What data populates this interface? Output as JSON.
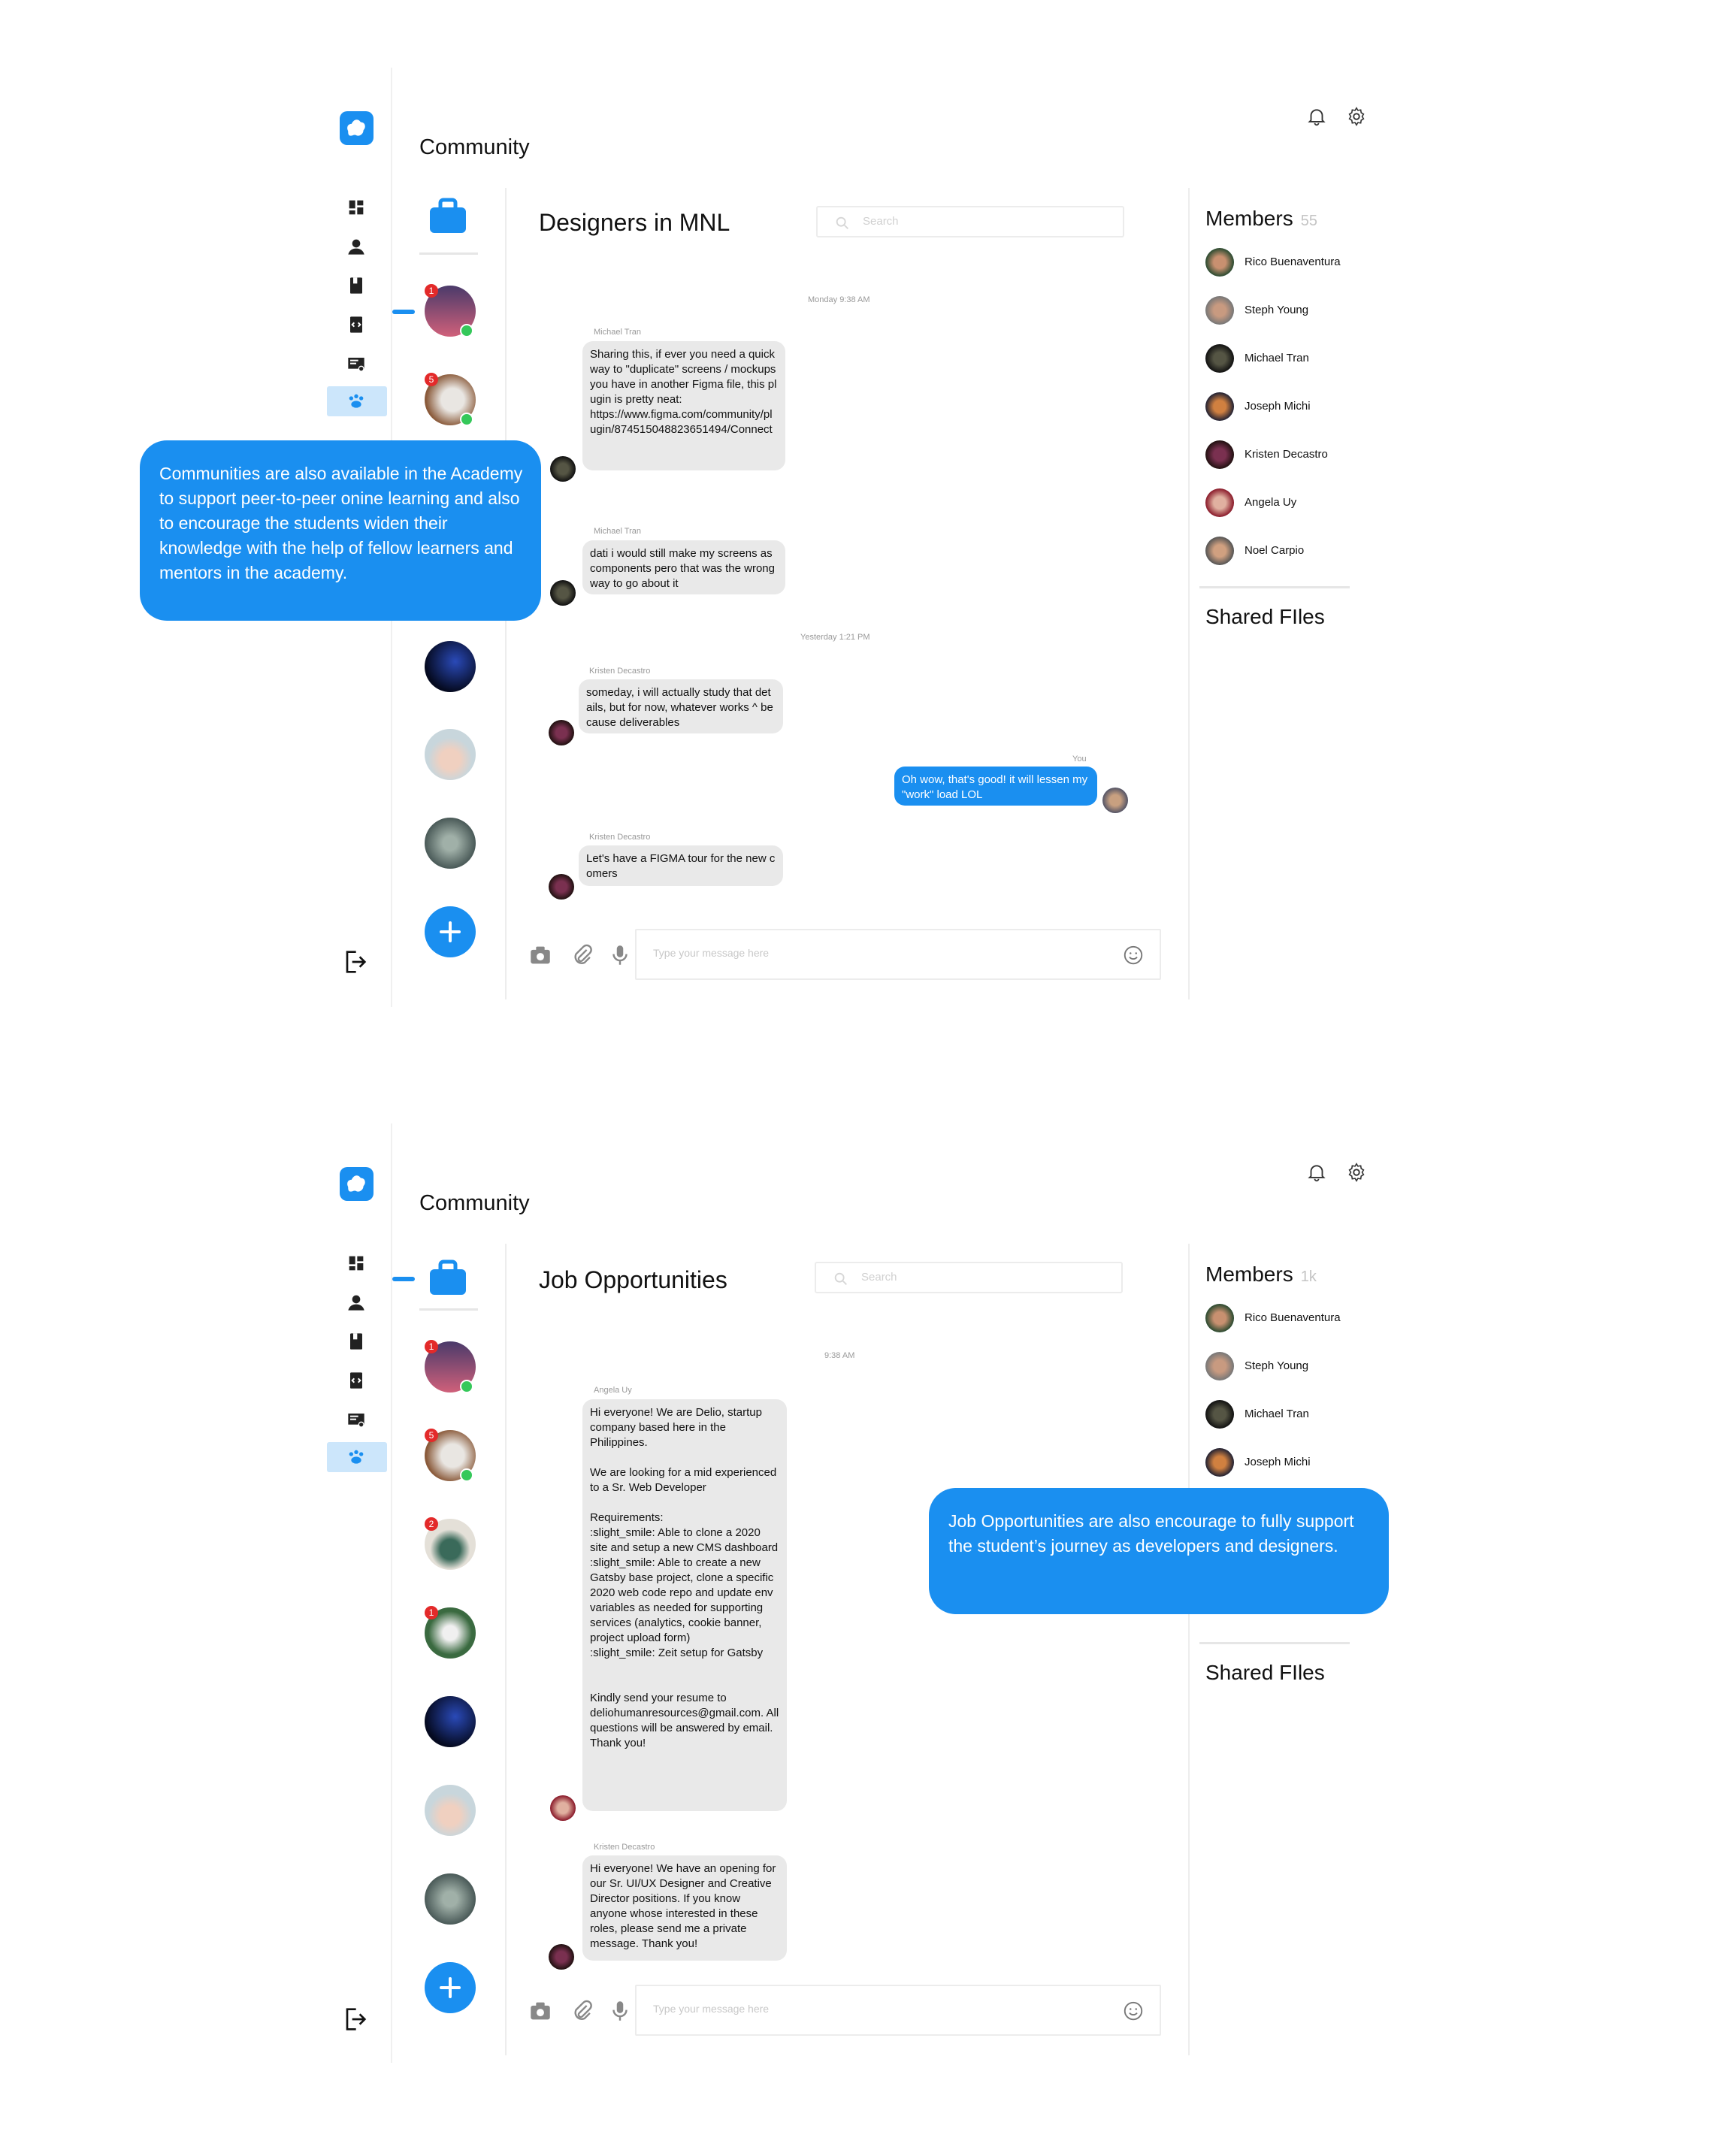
{
  "colors": {
    "accent": "#1a8ff0",
    "badge": "#e32a2a",
    "online": "#35c85a",
    "bubble": "#e9e9e9"
  },
  "icons": [
    "logo-icon",
    "dashboard-icon",
    "profile-icon",
    "book-icon",
    "code-icon",
    "certificate-icon",
    "community-icon",
    "logout-icon",
    "bell-icon",
    "gear-icon",
    "briefcase-icon",
    "search-icon",
    "camera-icon",
    "attach-icon",
    "mic-icon",
    "smile-icon",
    "plus-icon"
  ],
  "screens": [
    {
      "header_title": "Community",
      "channel_title": "Designers in MNL",
      "search_placeholder": "Search",
      "input_placeholder": "Type your message here",
      "members_title": "Members",
      "members_count": "55",
      "shared_files_title": "Shared FIles",
      "badges": [
        "1",
        "5"
      ],
      "timestamps": [
        "Monday 9:38 AM",
        "Yesterday 1:21 PM"
      ],
      "messages": [
        {
          "sender": "Michael Tran",
          "text": "Sharing this, if ever you need a quick way to \"duplicate\" screens / mockups you have in another Figma file, this plugin is pretty neat:\nhttps://www.figma.com/community/plugin/874515048823651494/Connect"
        },
        {
          "sender": "Michael Tran",
          "text": "dati i would still make my screens as components pero that was the wrong way to go about it"
        },
        {
          "sender": "Kristen Decastro",
          "text": "someday, i will actually study that details, but for now, whatever works ^ because deliverables"
        },
        {
          "sender": "You",
          "text": "Oh wow, that's good! it will lessen my \"work\" load LOL"
        },
        {
          "sender": "Kristen Decastro",
          "text": "Let's have a FIGMA tour for the new comers"
        }
      ],
      "members": [
        "Rico Buenaventura",
        "Steph Young",
        "Michael Tran",
        "Joseph Michi",
        "Kristen Decastro",
        "Angela Uy",
        "Noel Carpio"
      ],
      "callout": "Communities are also available in the Academy to support peer-to-peer onine learning and also to encourage the students widen their knowledge with the help of fellow learners and mentors in the academy."
    },
    {
      "header_title": "Community",
      "channel_title": "Job Opportunities",
      "search_placeholder": "Search",
      "input_placeholder": "Type your message here",
      "members_title": "Members",
      "members_count": "1k",
      "shared_files_title": "Shared FIles",
      "badges": [
        "1",
        "5",
        "2",
        "1"
      ],
      "timestamps": [
        "9:38 AM"
      ],
      "messages": [
        {
          "sender": "Angela Uy",
          "text": "Hi everyone! We are Delio, startup company based here in the Philippines.\n\nWe are looking for a mid experienced to a Sr. Web Developer\n\nRequirements:\n:slight_smile: Able to clone a 2020 site and setup a new CMS dashboard\n:slight_smile: Able to create a new Gatsby base project, clone a specific 2020 web code repo and update env variables as needed for supporting services (analytics, cookie banner, project upload form)\n:slight_smile: Zeit setup for Gatsby\n\n\nKindly send your resume to deliohumanresources@gmail.com. All questions will be answered by email. Thank you!"
        },
        {
          "sender": "Kristen Decastro",
          "text": "Hi everyone! We have an opening for our Sr. UI/UX Designer and Creative Director positions. If you know anyone whose interested in these roles, please send me a private message. Thank you!"
        }
      ],
      "members": [
        "Rico Buenaventura",
        "Steph Young",
        "Michael Tran",
        "Joseph Michi"
      ],
      "callout": "Job Opportunities are also encourage to fully support the student’s journey as developers and designers."
    }
  ]
}
